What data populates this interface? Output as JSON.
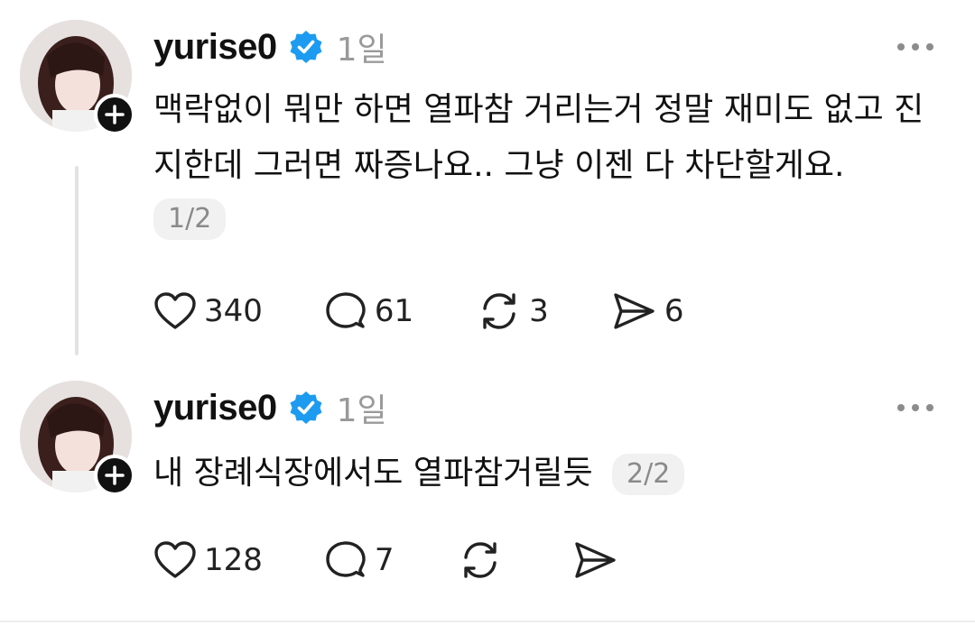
{
  "posts": [
    {
      "username": "yurise0",
      "time": "1일",
      "text": "맥락없이 뭐만 하면 열파참 거리는거 정말 재미도 없고 진지한데 그러면 짜증나요.. 그냥 이젠 다 차단할게요.",
      "page": "1/2",
      "likes": "340",
      "replies": "61",
      "reposts": "3",
      "shares": "6"
    },
    {
      "username": "yurise0",
      "time": "1일",
      "text": "내 장례식장에서도 열파참거릴듯",
      "page": "2/2",
      "likes": "128",
      "replies": "7",
      "reposts": "",
      "shares": ""
    }
  ],
  "icons": {
    "verified": "verified-badge-icon",
    "follow": "plus-icon",
    "more": "more-horizontal-icon",
    "like": "heart-icon",
    "reply": "comment-icon",
    "repost": "repost-icon",
    "share": "send-icon"
  },
  "colors": {
    "verified_blue": "#1d9bf0",
    "muted_text": "#9a9a9a"
  }
}
